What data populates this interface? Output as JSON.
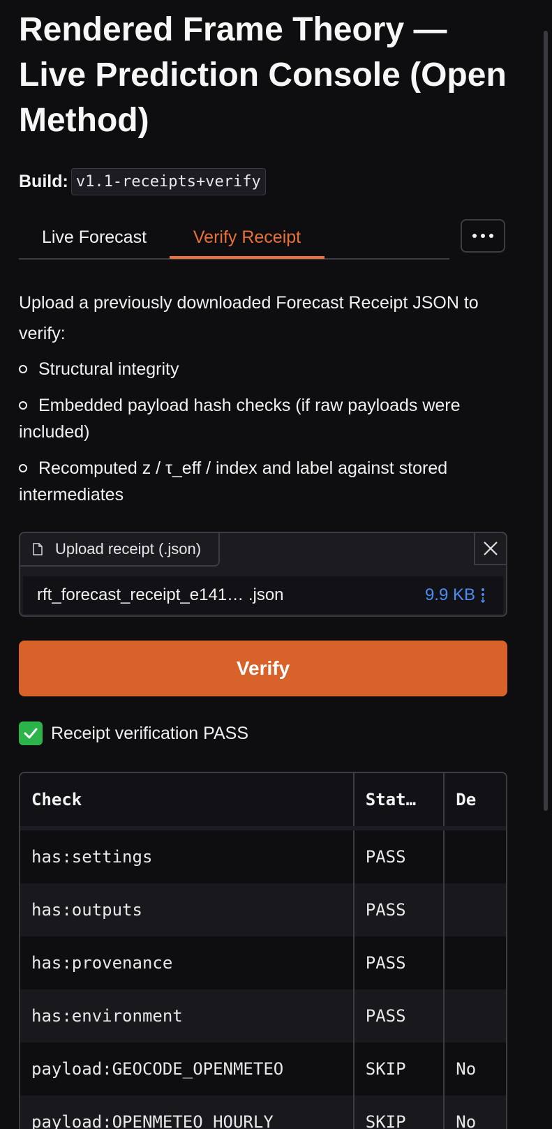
{
  "header": {
    "title": "Rendered Frame Theory — Live Prediction Console (Open Method)",
    "build_label": "Build:",
    "build_value": "v1.1-receipts+verify"
  },
  "tabs": [
    {
      "label": "Live Forecast",
      "active": false
    },
    {
      "label": "Verify Receipt",
      "active": true
    }
  ],
  "more_icon": "ellipsis-icon",
  "verify_panel": {
    "description": "Upload a previously downloaded Forecast Receipt JSON to verify:",
    "checks": [
      "Structural integrity",
      "Embedded payload hash checks (if raw payloads were included)",
      "Recomputed z / τ_eff / index and label against stored intermediates"
    ],
    "uploader": {
      "button_label": "Upload receipt (.json)",
      "file_name": "rft_forecast_receipt_e141… .json",
      "file_size": "9.9 KB"
    },
    "verify_button": "Verify",
    "result_text": "Receipt verification PASS",
    "table": {
      "columns": [
        "Check",
        "Stat…",
        "De"
      ],
      "rows": [
        {
          "check": "has:settings",
          "status": "PASS",
          "details": ""
        },
        {
          "check": "has:outputs",
          "status": "PASS",
          "details": ""
        },
        {
          "check": "has:provenance",
          "status": "PASS",
          "details": ""
        },
        {
          "check": "has:environment",
          "status": "PASS",
          "details": ""
        },
        {
          "check": "payload:GEOCODE_OPENMETEO",
          "status": "SKIP",
          "details": "No"
        },
        {
          "check": "payload:OPENMETEO_HOURLY",
          "status": "SKIP",
          "details": "No"
        }
      ]
    }
  },
  "colors": {
    "accent": "#e8703a",
    "button": "#d9622b",
    "link": "#4a8df0",
    "success": "#2cb34a",
    "background": "#0e0e11"
  }
}
